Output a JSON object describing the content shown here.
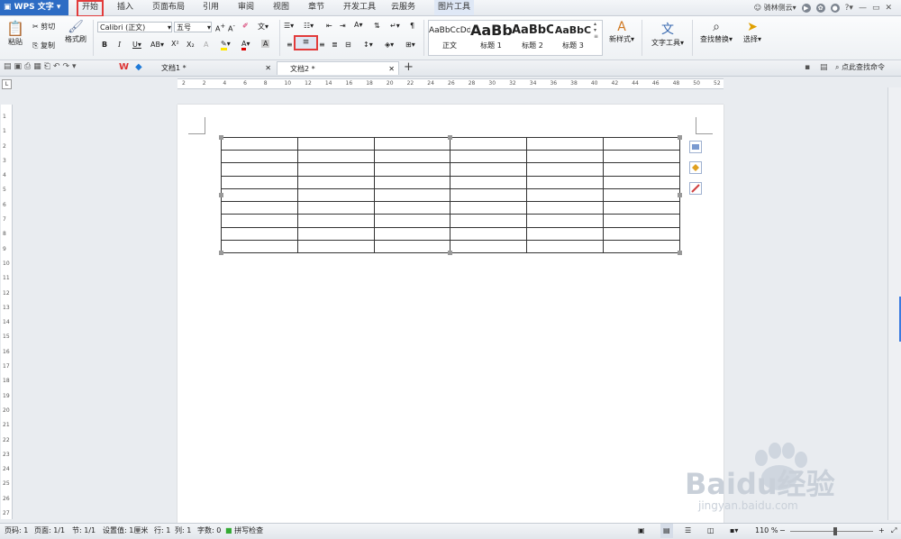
{
  "app": {
    "menu_label": "WPS 文字",
    "tabs": [
      "开始",
      "插入",
      "页面布局",
      "引用",
      "审阅",
      "视图",
      "章节",
      "开发工具",
      "云服务",
      "图片工具"
    ],
    "user": "骑林侧云"
  },
  "ribbon": {
    "clipboard": {
      "paste": "粘贴",
      "cut": "剪切",
      "copy": "复制",
      "format_painter": "格式刷"
    },
    "font_name": "Calibri (正文)",
    "font_size": "五号",
    "styles": [
      {
        "sample": "AaBbCcDd",
        "name": "正文"
      },
      {
        "sample": "AaBb",
        "name": "标题 1"
      },
      {
        "sample": "AaBbC",
        "name": "标题 2"
      },
      {
        "sample": "AaBbC",
        "name": "标题 3"
      }
    ],
    "new_style": "新样式",
    "text_tools": "文字工具",
    "find_replace": "查找替换",
    "select": "选择"
  },
  "doc_tabs": [
    {
      "title": "文档1 *"
    },
    {
      "title": "文档2 *"
    }
  ],
  "search_placeholder": "点此查找命令",
  "hruler_ticks": [
    "2",
    "2",
    "4",
    "6",
    "8",
    "10",
    "12",
    "14",
    "16",
    "18",
    "20",
    "22",
    "24",
    "26",
    "28",
    "30",
    "32",
    "34",
    "36",
    "38",
    "40",
    "42",
    "44",
    "46",
    "48",
    "50",
    "52"
  ],
  "vruler_ticks": [
    "1",
    "1",
    "2",
    "3",
    "4",
    "5",
    "6",
    "7",
    "8",
    "9",
    "10",
    "11",
    "12",
    "13",
    "14",
    "15",
    "16",
    "17",
    "18",
    "19",
    "20",
    "21",
    "22",
    "23",
    "24",
    "25",
    "26",
    "27"
  ],
  "table": {
    "rows": 9,
    "cols": 6
  },
  "status": {
    "page_code": "页码: 1",
    "page": "页面: 1/1",
    "section": "节: 1/1",
    "setting": "设置值: 1厘米",
    "row": "行: 1",
    "col": "列: 1",
    "word_count": "字数: 0",
    "spell_check": "拼写检查",
    "zoom": "110 %"
  },
  "watermark": {
    "brand": "Baidu经验",
    "url": "jingyan.baidu.com"
  },
  "colors": {
    "accent": "#2d6cc4",
    "highlight_box": "#e23b3b"
  }
}
